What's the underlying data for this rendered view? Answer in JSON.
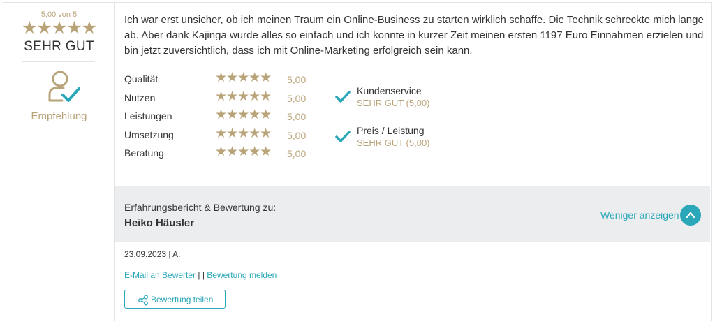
{
  "summary": {
    "score_text": "5,00 von 5",
    "stars": "★★★★★",
    "verdict": "SEHR GUT",
    "recommendation_label": "Empfehlung",
    "score_value": 5.0,
    "score_max": 5
  },
  "review": {
    "text": "Ich war erst unsicher, ob ich meinen Traum ein Online-Business zu starten wirklich schaffe. Die Technik schreckte mich lange ab. Aber dank Kajinga wurde alles so einfach und ich konnte in kurzer Zeit meinen ersten 1197 Euro Einnahmen erzielen und bin jetzt zuversichtlich, dass ich mit Online-Marketing erfolgreich sein kann."
  },
  "ratings": [
    {
      "label": "Qualität",
      "stars": "★★★★★",
      "value": "5,00"
    },
    {
      "label": "Nutzen",
      "stars": "★★★★★",
      "value": "5,00"
    },
    {
      "label": "Leistungen",
      "stars": "★★★★★",
      "value": "5,00"
    },
    {
      "label": "Umsetzung",
      "stars": "★★★★★",
      "value": "5,00"
    },
    {
      "label": "Beratung",
      "stars": "★★★★★",
      "value": "5,00"
    }
  ],
  "checks": [
    {
      "title": "Kundenservice",
      "sub": "SEHR GUT (5,00)"
    },
    {
      "title": "Preis / Leistung",
      "sub": "SEHR GUT (5,00)"
    }
  ],
  "author": {
    "caption": "Erfahrungsbericht & Bewertung zu:",
    "name": "Heiko Häusler",
    "toggle_label": "Weniger anzeigen"
  },
  "meta": {
    "date": "23.09.2023 | A.",
    "email_link": "E-Mail an Bewerter",
    "separator": " | | ",
    "report_link": "Bewertung melden",
    "share_label": "Bewertung teilen"
  },
  "icons": {
    "recommend": "user-check-icon",
    "check": "checkmark-icon",
    "toggle": "chevron-up-icon",
    "share": "share-icon"
  },
  "colors": {
    "gold": "#b9a47a",
    "teal": "#2aa7b9",
    "bar_bg": "#ebedef"
  }
}
